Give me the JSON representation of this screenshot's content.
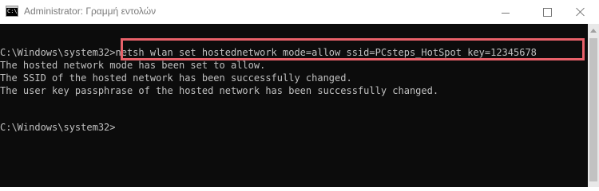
{
  "window": {
    "title": "Administrator: Γραμμή εντολών",
    "icon": "cmd-icon",
    "icon_text": "C:\\"
  },
  "controls": {
    "minimize_icon": "minimize-icon",
    "maximize_icon": "maximize-icon",
    "close_icon": "close-icon"
  },
  "console": {
    "lines": [
      "C:\\Windows\\system32>netsh wlan set hostednetwork mode=allow ssid=PCsteps_HotSpot key=12345678",
      "The hosted network mode has been set to allow.",
      "The SSID of the hosted network has been successfully changed.",
      "The user key passphrase of the hosted network has been successfully changed.",
      "C:\\Windows\\system32>"
    ]
  },
  "colors": {
    "console_bg": "#0c0c0c",
    "console_text": "#c0c0c0",
    "highlight": "#e8616a"
  }
}
